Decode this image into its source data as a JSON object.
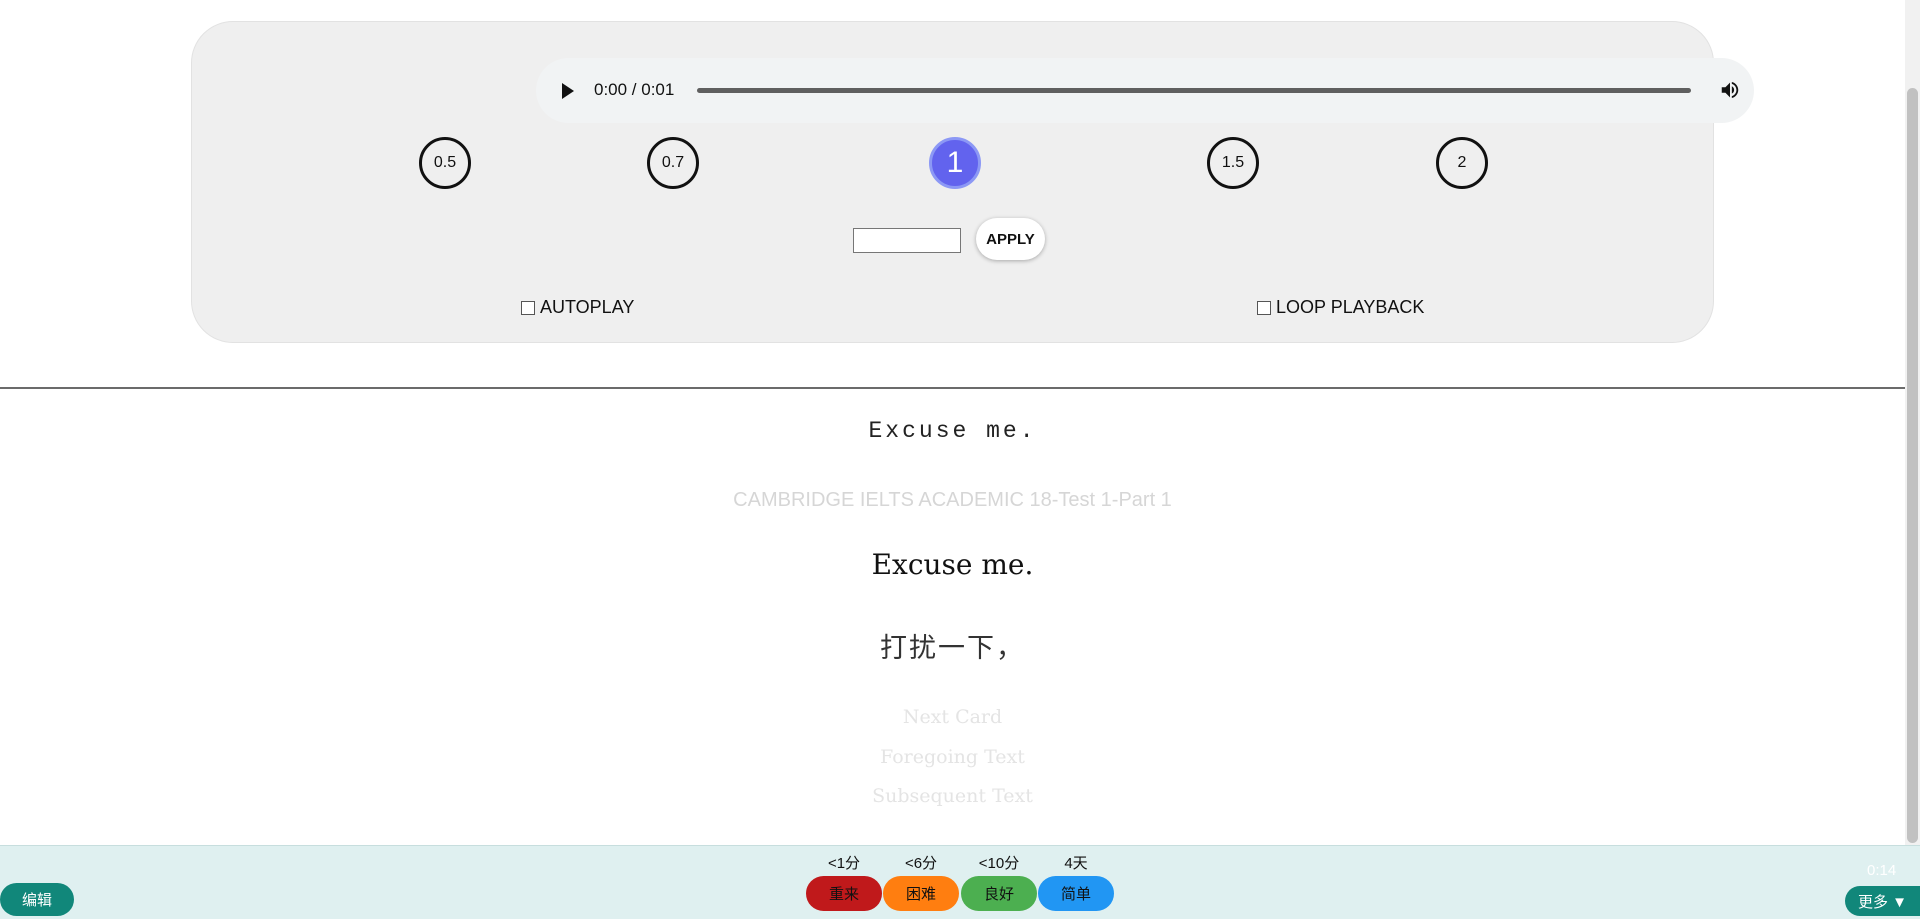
{
  "player": {
    "time_display": "0:00 / 0:01",
    "speeds": [
      "0.5",
      "0.7",
      "1",
      "1.5",
      "2"
    ],
    "active_speed": "1",
    "apply_label": "APPLY",
    "autoplay_label": "AUTOPLAY",
    "loop_label": "LOOP PLAYBACK"
  },
  "card": {
    "front": "Excuse me.",
    "source": "CAMBRIDGE IELTS ACADEMIC 18-Test 1-Part 1",
    "answer": "Excuse me.",
    "translation": "打扰一下，",
    "next_card": "Next Card",
    "foregoing": "Foregoing Text",
    "subsequent": "Subsequent Text"
  },
  "bottom": {
    "edit_label": "编辑",
    "ease": [
      {
        "time": "<1分",
        "label": "重来",
        "color": "#c0191b"
      },
      {
        "time": "<6分",
        "label": "困难",
        "color": "#ff7e10"
      },
      {
        "time": "<10分",
        "label": "良好",
        "color": "#4caf50"
      },
      {
        "time": "4天",
        "label": "简单",
        "color": "#2196f3"
      }
    ],
    "timer": "0:14",
    "more_label": "更多 ▼"
  }
}
